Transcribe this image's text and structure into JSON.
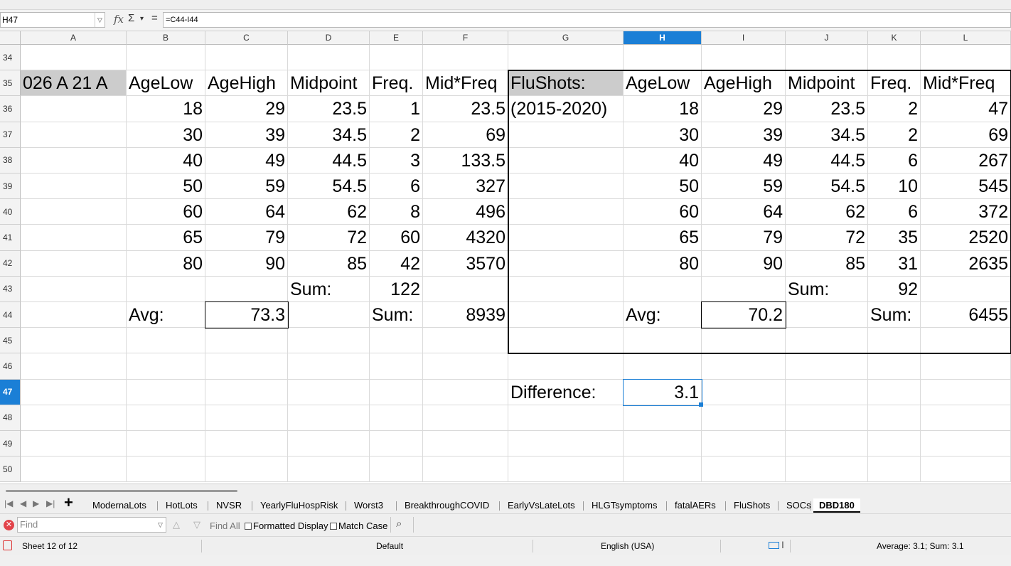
{
  "formula_bar": {
    "name_box": "H47",
    "formula": "=C44-I44",
    "fx_symbol": "fx",
    "sum_symbol": "Σ",
    "equals_symbol": "="
  },
  "columns": [
    "A",
    "B",
    "C",
    "D",
    "E",
    "F",
    "G",
    "H",
    "I",
    "J",
    "K",
    "L"
  ],
  "selected_column": "H",
  "rows": [
    "34",
    "35",
    "36",
    "37",
    "38",
    "39",
    "40",
    "41",
    "42",
    "43",
    "44",
    "45",
    "46",
    "47",
    "48",
    "49",
    "50"
  ],
  "selected_row": "47",
  "cells": {
    "A35": "026 A 21 A",
    "B35": "AgeLow",
    "C35": "AgeHigh",
    "D35": "Midpoint",
    "E35": "Freq.",
    "F35": "Mid*Freq",
    "B36": "18",
    "C36": "29",
    "D36": "23.5",
    "E36": "1",
    "F36": "23.5",
    "B37": "30",
    "C37": "39",
    "D37": "34.5",
    "E37": "2",
    "F37": "69",
    "B38": "40",
    "C38": "49",
    "D38": "44.5",
    "E38": "3",
    "F38": "133.5",
    "B39": "50",
    "C39": "59",
    "D39": "54.5",
    "E39": "6",
    "F39": "327",
    "B40": "60",
    "C40": "64",
    "D40": "62",
    "E40": "8",
    "F40": "496",
    "B41": "65",
    "C41": "79",
    "D41": "72",
    "E41": "60",
    "F41": "4320",
    "B42": "80",
    "C42": "90",
    "D42": "85",
    "E42": "42",
    "F42": "3570",
    "D43": "Sum:",
    "E43": "122",
    "B44": "Avg:",
    "C44": "73.3",
    "E44": "Sum:",
    "F44": "8939",
    "G35": "FluShots:",
    "H35": "AgeLow",
    "I35": "AgeHigh",
    "J35": "Midpoint",
    "K35": "Freq.",
    "L35": "Mid*Freq",
    "G36": "(2015-2020)",
    "H36": "18",
    "I36": "29",
    "J36": "23.5",
    "K36": "2",
    "L36": "47",
    "H37": "30",
    "I37": "39",
    "J37": "34.5",
    "K37": "2",
    "L37": "69",
    "H38": "40",
    "I38": "49",
    "J38": "44.5",
    "K38": "6",
    "L38": "267",
    "H39": "50",
    "I39": "59",
    "J39": "54.5",
    "K39": "10",
    "L39": "545",
    "H40": "60",
    "I40": "64",
    "J40": "62",
    "K40": "6",
    "L40": "372",
    "H41": "65",
    "I41": "79",
    "J41": "72",
    "K41": "35",
    "L41": "2520",
    "H42": "80",
    "I42": "90",
    "J42": "85",
    "K42": "31",
    "L42": "2635",
    "J43": "Sum:",
    "K43": "92",
    "H44": "Avg:",
    "I44": "70.2",
    "K44": "Sum:",
    "L44": "6455",
    "G47": "Difference:",
    "H47": "3.1"
  },
  "sheet_tabs": [
    "ModernaLots",
    "HotLots",
    "NVSR",
    "YearlyFluHospRisk",
    "Worst3",
    "BreakthroughCOVID",
    "EarlyVsLateLots",
    "HLGTsymptoms",
    "fatalAERs",
    "FluShots",
    "SOCs",
    "DBD180"
  ],
  "active_tab": "DBD180",
  "find_bar": {
    "placeholder": "Find",
    "find_all": "Find All",
    "formatted_display": "Formatted Display",
    "match_case": "Match Case"
  },
  "status_bar": {
    "sheet": "Sheet 12 of 12",
    "page_style": "Default",
    "language": "English (USA)",
    "summary": "Average: 3.1; Sum: 3.1"
  },
  "colors": {
    "selection_blue": "#1b7fd6",
    "header_gray": "#cccccc"
  }
}
